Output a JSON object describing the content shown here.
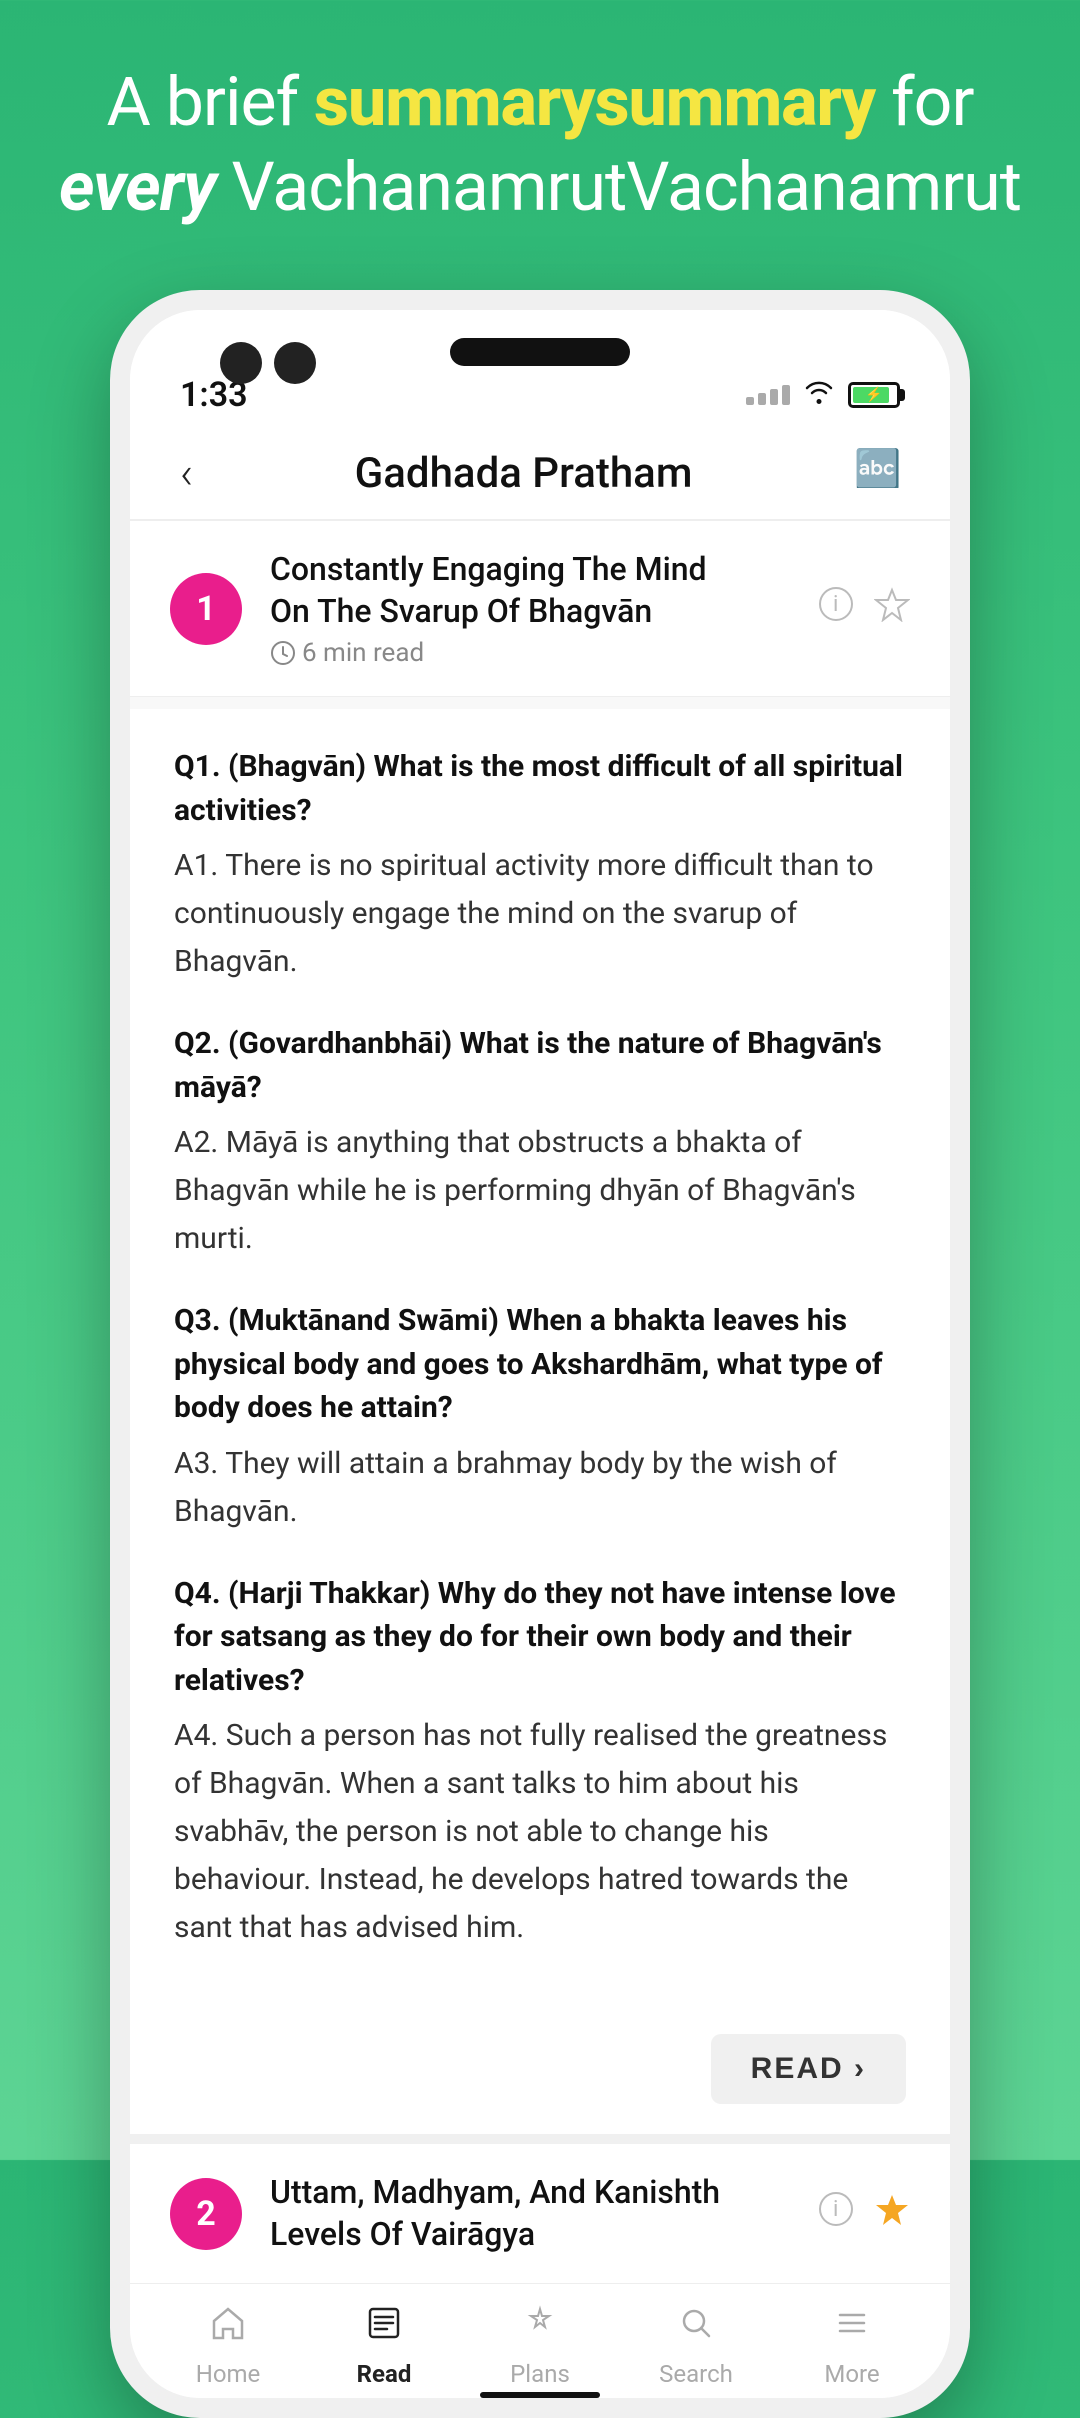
{
  "header": {
    "line1_plain": "A brief",
    "line1_highlight": "summary",
    "line1_end": "for",
    "line2_italic": "every",
    "line2_end": "Vachanamrut"
  },
  "status_bar": {
    "time": "1:33",
    "wifi": "📶",
    "battery_pct": 85
  },
  "navbar": {
    "back_label": "‹",
    "title": "Gadhada Pratham",
    "translate_icon": "🔤"
  },
  "vachanamrut_1": {
    "number": "1",
    "title_line1": "Constantly Engaging The Mind",
    "title_line2": "On The Svarup Of Bhagvān",
    "read_time": "6 min read",
    "qa": [
      {
        "question": "Q1. (Bhagvān) What is the most difficult of all spiritual activities?",
        "answer": "A1. There is no spiritual activity more difficult than to continuously engage the mind on the svarup of Bhagvān."
      },
      {
        "question": "Q2. (Govardhanbhāi) What is the nature of Bhagvān's māyā?",
        "answer": "A2. Māyā is anything that obstructs a bhakta of Bhagvān while he is performing dhyān of Bhagvān's murti."
      },
      {
        "question": "Q3. (Muktānand Swāmi) When a bhakta leaves his physical body and goes to Akshardhām, what type of body does he attain?",
        "answer": "A3. They will attain a brahmay body by the wish of Bhagvān."
      },
      {
        "question": "Q4. (Harji Thakkar) Why do they not have intense love for satsang as they do for their own body and their relatives?",
        "answer": "A4. Such a person has not fully realised the greatness of Bhagvān. When a sant talks to him about his svabhāv, the person is not able to change his behaviour. Instead, he develops hatred towards the sant that has advised him."
      }
    ],
    "read_button": "READ ›"
  },
  "vachanamrut_2": {
    "number": "2",
    "title_line1": "Uttam, Madhyam, And Kanishth",
    "title_line2": "Levels Of Vairāgya",
    "is_starred": true
  },
  "bottom_nav": {
    "items": [
      {
        "id": "home",
        "label": "Home",
        "icon": "home",
        "active": false
      },
      {
        "id": "read",
        "label": "Read",
        "icon": "read",
        "active": true
      },
      {
        "id": "plans",
        "label": "Plans",
        "icon": "plans",
        "active": false
      },
      {
        "id": "search",
        "label": "Search",
        "icon": "search",
        "active": false
      },
      {
        "id": "more",
        "label": "More",
        "icon": "more",
        "active": false
      }
    ]
  }
}
